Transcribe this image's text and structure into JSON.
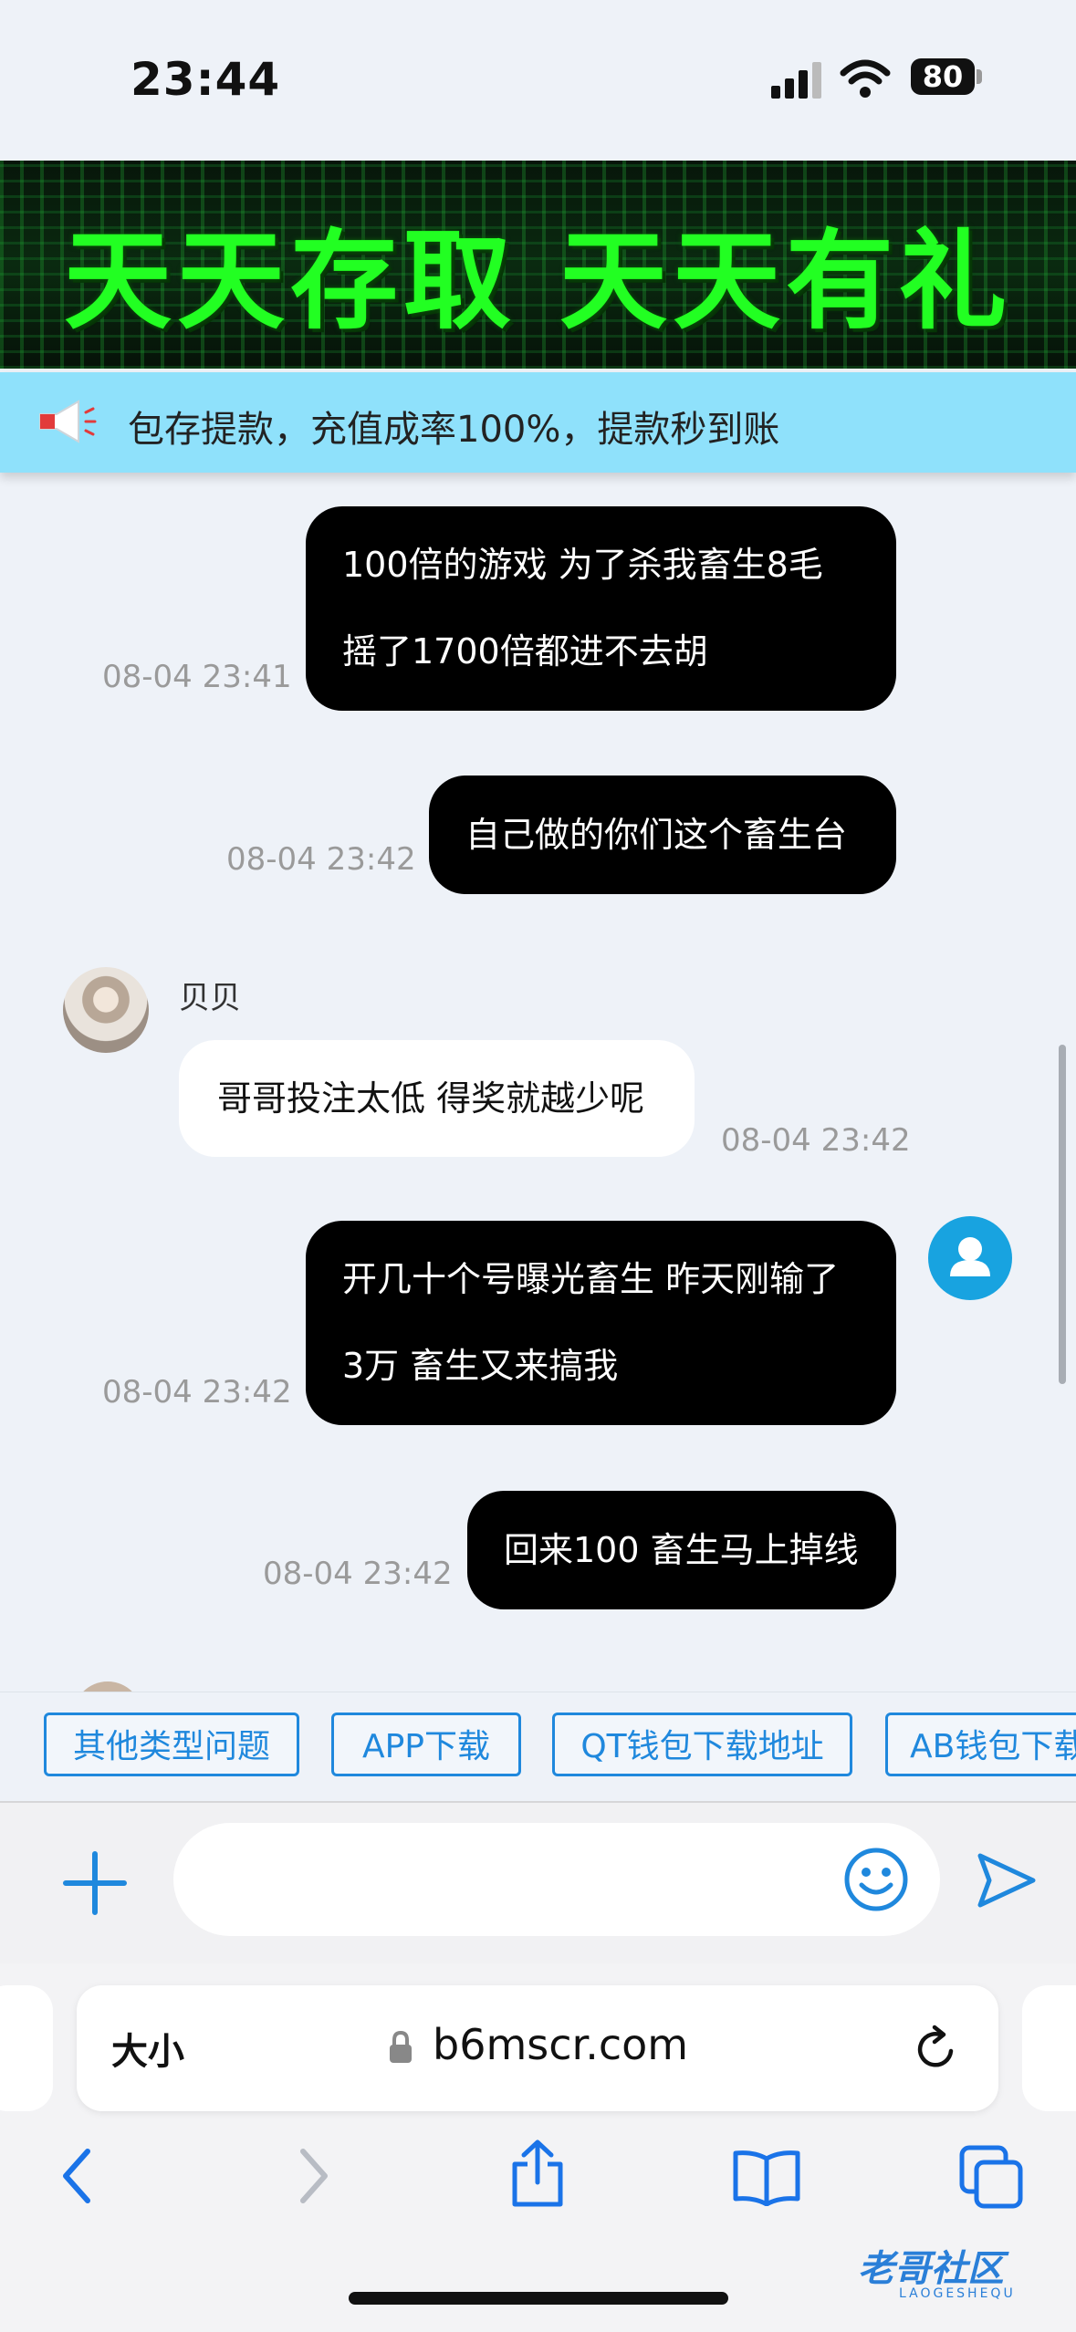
{
  "status_bar": {
    "time": "23:44",
    "battery": "80"
  },
  "banner": {
    "text": "天天存取 天天有礼"
  },
  "notice": {
    "text": "包存提款，充值成率100%，提款秒到账"
  },
  "messages": [
    {
      "side": "right",
      "lines": [
        "100倍的游戏 为了杀我畜生8毛",
        "摇了1700倍都进不去胡"
      ],
      "time": "08-04 23:41"
    },
    {
      "side": "right",
      "lines": [
        "自己做的你们这个畜生台"
      ],
      "time": "08-04 23:42"
    },
    {
      "side": "left",
      "sender": "贝贝",
      "lines": [
        "哥哥投注太低 得奖就越少呢"
      ],
      "time": "08-04 23:42"
    },
    {
      "side": "right",
      "lines": [
        "开几十个号曝光畜生 昨天刚输了",
        "3万 畜生又来搞我"
      ],
      "time": "08-04 23:42"
    },
    {
      "side": "right",
      "lines": [
        "回来100 畜生马上掉线"
      ],
      "time": "08-04 23:42"
    }
  ],
  "quick_replies": [
    "其他类型问题",
    "APP下载",
    "QT钱包下载地址",
    "AB钱包下载"
  ],
  "input": {
    "placeholder": ""
  },
  "browser": {
    "text_size_label": "大小",
    "url": "b6mscr.com"
  },
  "watermark": {
    "text": "老哥社区",
    "sub": "LAOGESHEQU"
  },
  "colors": {
    "accent": "#1f88dd",
    "notice_bg": "#8fe1fb",
    "banner_text": "#22ff22"
  }
}
